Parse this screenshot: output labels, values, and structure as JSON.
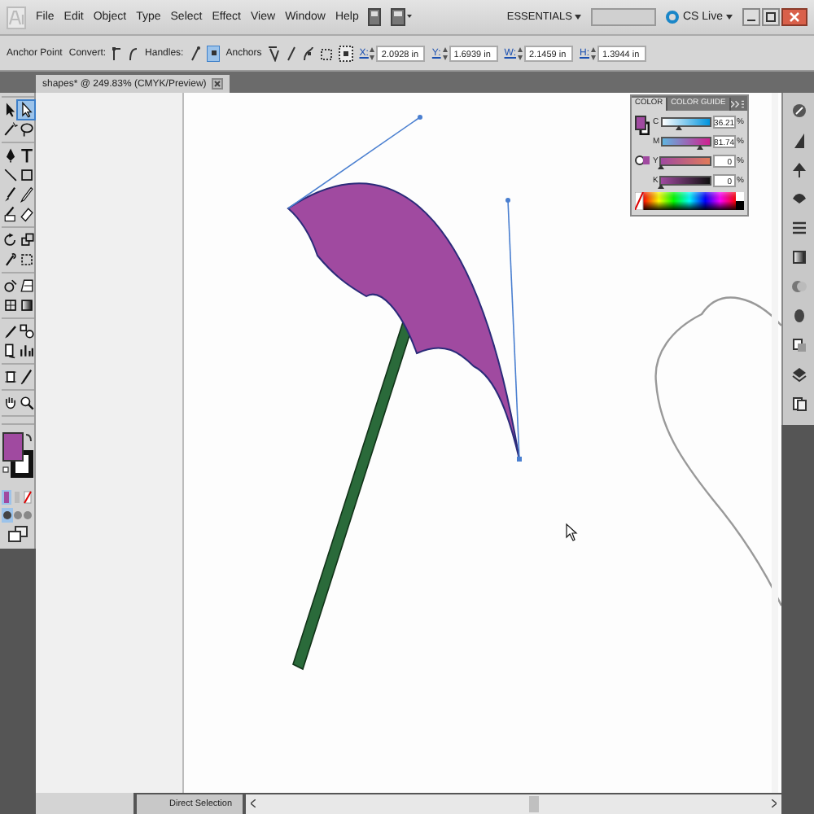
{
  "menu_bar": {
    "menus": [
      "File",
      "Edit",
      "Object",
      "Type",
      "Select",
      "Effect",
      "View",
      "Window",
      "Help"
    ],
    "workspace": "ESSENTIALS",
    "cs_live": "CS Live"
  },
  "control_bar": {
    "tool": "Anchor Point",
    "convert_label": "Convert:",
    "handles_label": "Handles:",
    "anchors_label": "Anchors",
    "fields": [
      {
        "label": "X:",
        "value": "2.0928 in"
      },
      {
        "label": "Y:",
        "value": "1.6939 in"
      },
      {
        "label": "W:",
        "value": "2.1459 in"
      },
      {
        "label": "H:",
        "value": "1.3944 in"
      }
    ]
  },
  "document_tab": {
    "title": "shapes* @ 249.83% (CMYK/Preview)"
  },
  "toolbox": {
    "tools": [
      {
        "kind": "selection",
        "selected": false
      },
      {
        "kind": "direct",
        "selected": true
      },
      {
        "kind": "wand",
        "selected": false
      },
      {
        "kind": "lasso",
        "selected": false
      },
      {
        "kind": "pen",
        "selected": false
      },
      {
        "kind": "type",
        "selected": false
      },
      {
        "kind": "line",
        "selected": false
      },
      {
        "kind": "rect",
        "selected": false
      },
      {
        "kind": "brush",
        "selected": false
      },
      {
        "kind": "pencil",
        "selected": false
      },
      {
        "kind": "blob",
        "selected": false
      },
      {
        "kind": "eraser",
        "selected": false
      },
      {
        "kind": "rotate",
        "selected": false
      },
      {
        "kind": "scale",
        "selected": false
      },
      {
        "kind": "warp",
        "selected": false
      },
      {
        "kind": "transform",
        "selected": false
      },
      {
        "kind": "shape",
        "selected": false
      },
      {
        "kind": "perspective",
        "selected": false
      },
      {
        "kind": "mesh",
        "selected": false
      },
      {
        "kind": "gradient",
        "selected": false
      },
      {
        "kind": "eyedropper",
        "selected": false
      },
      {
        "kind": "blend",
        "selected": false
      },
      {
        "kind": "symbol",
        "selected": false
      },
      {
        "kind": "graph",
        "selected": false
      },
      {
        "kind": "artboard",
        "selected": false
      },
      {
        "kind": "slice",
        "selected": false
      },
      {
        "kind": "hand",
        "selected": false
      },
      {
        "kind": "zoom",
        "selected": false
      }
    ]
  },
  "color_panel": {
    "tabs": [
      {
        "label": "COLOR",
        "selected": true
      },
      {
        "label": "COLOR GUIDE",
        "selected": false
      }
    ],
    "channels": [
      {
        "name": "C",
        "value": "36.21",
        "unit": "%",
        "level": 0.3621
      },
      {
        "name": "M",
        "value": "81.74",
        "unit": "%",
        "level": 0.8174
      },
      {
        "name": "Y",
        "value": "0",
        "unit": "%",
        "level": 0
      },
      {
        "name": "K",
        "value": "0",
        "unit": "%",
        "level": 0
      }
    ]
  },
  "status_bar": {
    "tool": "Direct Selection"
  }
}
